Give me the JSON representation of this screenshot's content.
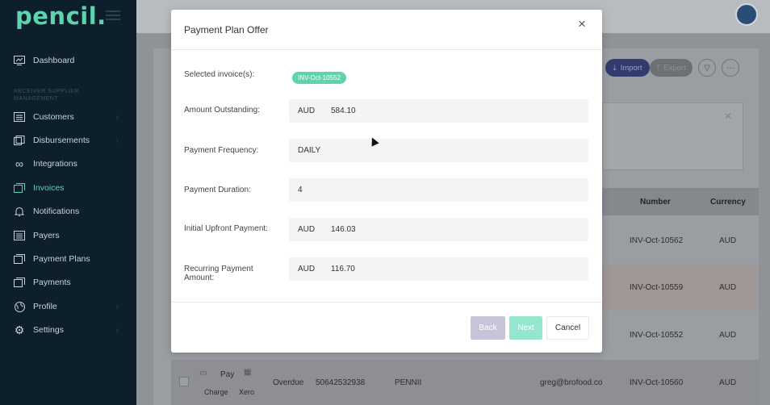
{
  "app": {
    "logo": "pencil."
  },
  "sidebar": {
    "section_label": "RECEIVER SUPPLIER MANAGEMENT",
    "items": [
      {
        "label": "Dashboard",
        "icon": "monitor-icon",
        "active": false
      },
      {
        "label": "Customers",
        "icon": "list-icon",
        "active": false
      },
      {
        "label": "Disbursements",
        "icon": "stack-icon",
        "active": false
      },
      {
        "label": "Integrations",
        "icon": "infinity-icon",
        "active": false
      },
      {
        "label": "Invoices",
        "icon": "documents-icon",
        "active": true
      },
      {
        "label": "Notifications",
        "icon": "bell-icon",
        "active": false
      },
      {
        "label": "Payers",
        "icon": "list-icon",
        "active": false
      },
      {
        "label": "Payment Plans",
        "icon": "documents-icon",
        "active": false
      },
      {
        "label": "Payments",
        "icon": "documents-icon",
        "active": false
      },
      {
        "label": "Profile",
        "icon": "globe-icon",
        "active": false
      },
      {
        "label": "Settings",
        "icon": "gear-icon",
        "active": false
      }
    ]
  },
  "toolbar": {
    "import_label": "Import",
    "export_label": "Export"
  },
  "table": {
    "headers": {
      "number": "Number",
      "currency": "Currency"
    },
    "rows": [
      {
        "number": "INV-Oct-10562",
        "currency": "AUD"
      },
      {
        "number": "INV-Oct-10559",
        "currency": "AUD"
      },
      {
        "number": "INV-Oct-10552",
        "currency": "AUD"
      }
    ],
    "bottom_row": {
      "pay": "Pay",
      "charge": "Charge",
      "xero": "Xero",
      "status": "Overdue",
      "reference": "50642532938",
      "customer": "PENNII",
      "email": "greg@brofood.co",
      "number": "INV-Oct-10560",
      "currency": "AUD"
    }
  },
  "modal": {
    "title": "Payment Plan Offer",
    "selected_invoices_label": "Selected invoice(s):",
    "selected_invoice_chip": "INV-Oct-10552",
    "amount_outstanding_label": "Amount Outstanding:",
    "amount_outstanding_currency": "AUD",
    "amount_outstanding_value": "584.10",
    "payment_frequency_label": "Payment Frequency:",
    "payment_frequency_value": "DAILY",
    "payment_duration_label": "Payment Duration:",
    "payment_duration_value": "4",
    "initial_upfront_label": "Initial Upfront Payment:",
    "initial_upfront_currency": "AUD",
    "initial_upfront_value": "146.03",
    "recurring_label": "Recurring Payment Amount:",
    "recurring_currency": "AUD",
    "recurring_value": "116.70",
    "back_label": "Back",
    "next_label": "Next",
    "cancel_label": "Cancel",
    "close_symbol": "×"
  },
  "colors": {
    "sidebar_bg": "#0c1f2b",
    "accent": "#5fd3b0",
    "next_button": "#94e7ce",
    "back_button": "#c5c4d9"
  }
}
